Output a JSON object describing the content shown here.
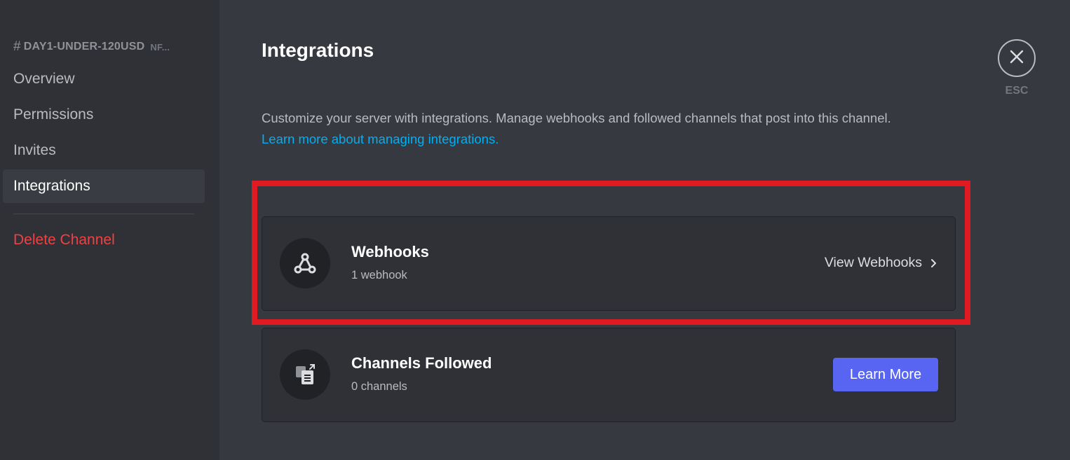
{
  "sidebar": {
    "channel_hash": "#",
    "channel_name": "DAY1-UNDER-120USD",
    "category": "NF...",
    "items": [
      {
        "label": "Overview"
      },
      {
        "label": "Permissions"
      },
      {
        "label": "Invites"
      },
      {
        "label": "Integrations"
      }
    ],
    "delete_label": "Delete Channel"
  },
  "main": {
    "title": "Integrations",
    "description": "Customize your server with integrations. Manage webhooks and followed channels that post into this channel.",
    "learn_more_link": "Learn more about managing integrations.",
    "webhooks": {
      "title": "Webhooks",
      "subtitle": "1 webhook",
      "action": "View Webhooks",
      "icon": "webhook-icon"
    },
    "channels_followed": {
      "title": "Channels Followed",
      "subtitle": "0 channels",
      "action": "Learn More",
      "icon": "channel-follow-icon"
    }
  },
  "close": {
    "icon": "close-icon",
    "label": "ESC"
  },
  "colors": {
    "background": "#36393f",
    "sidebar": "#2f3136",
    "accent": "#5865f2",
    "danger": "#ed4245",
    "link": "#00aff4",
    "highlight": "#e11a22"
  }
}
